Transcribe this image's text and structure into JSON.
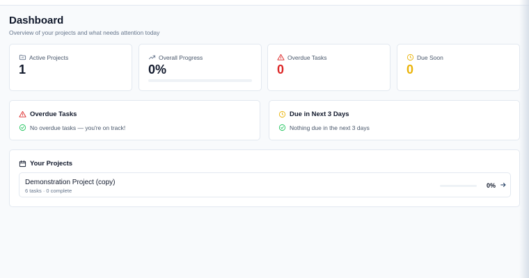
{
  "header": {
    "title": "Dashboard",
    "subtitle": "Overview of your projects and what needs attention today"
  },
  "stats": [
    {
      "label": "Active Projects",
      "value": "1",
      "icon": "folder-icon",
      "color": "#0f172a"
    },
    {
      "label": "Overall Progress",
      "value": "0%",
      "icon": "trending-up-icon",
      "color": "#0f172a",
      "progress": 0
    },
    {
      "label": "Overdue Tasks",
      "value": "0",
      "icon": "alert-triangle-icon",
      "color": "#dc2626"
    },
    {
      "label": "Due Soon",
      "value": "0",
      "icon": "clock-icon",
      "color": "#eab308"
    }
  ],
  "panels": {
    "overdue": {
      "title": "Overdue Tasks",
      "message": "No overdue tasks — you're on track!"
    },
    "due_soon": {
      "title": "Due in Next 3 Days",
      "message": "Nothing due in the next 3 days"
    }
  },
  "projects": {
    "title": "Your Projects",
    "items": [
      {
        "name": "Demonstration Project (copy)",
        "meta": "6 tasks · 0 complete",
        "percent": "0%",
        "progress": 0
      }
    ]
  },
  "colors": {
    "accent": "#0f172a",
    "danger": "#dc2626",
    "warning": "#eab308",
    "success": "#22c55e",
    "muted": "#64748b"
  }
}
